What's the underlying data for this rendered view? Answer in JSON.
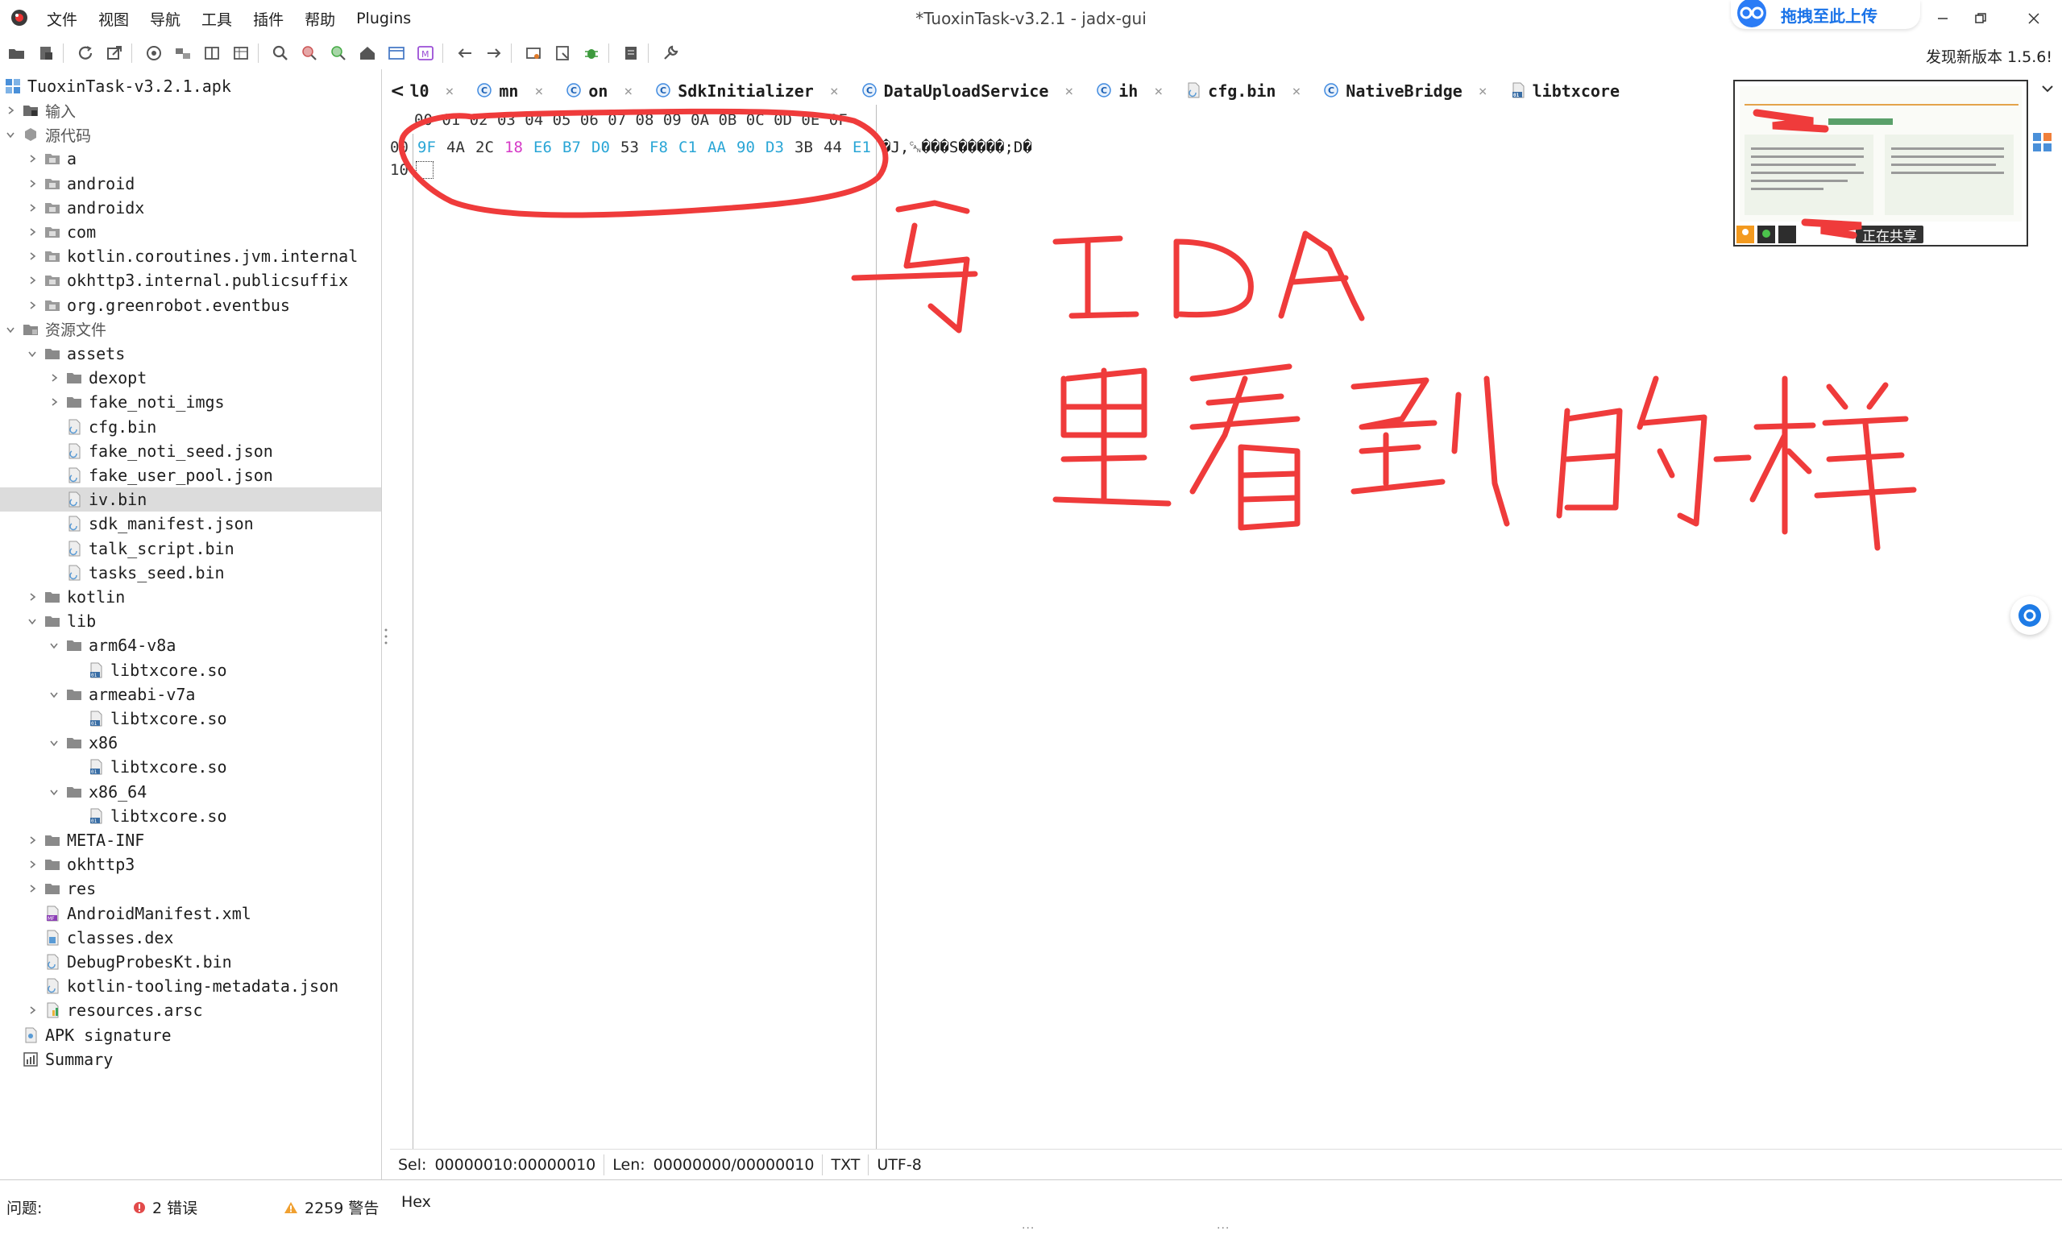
{
  "app": {
    "window_title": "*TuoxinTask-v3.2.1 - jadx-gui",
    "update_notice": "发现新版本 1.5.6!"
  },
  "menu": [
    "文件",
    "视图",
    "导航",
    "工具",
    "插件",
    "帮助",
    "Plugins"
  ],
  "baidu_upload": {
    "label": "拖拽至此上传"
  },
  "tree": {
    "root": "TuoxinTask-v3.2.1.apk",
    "items": [
      {
        "label": "输入",
        "depth": 1,
        "arrow": "right",
        "icon": "input-folder-icon",
        "cjk": true
      },
      {
        "label": "源代码",
        "depth": 1,
        "arrow": "down",
        "icon": "source-folder-icon",
        "cjk": true
      },
      {
        "label": "a",
        "depth": 2,
        "arrow": "right",
        "icon": "package-icon"
      },
      {
        "label": "android",
        "depth": 2,
        "arrow": "right",
        "icon": "package-icon"
      },
      {
        "label": "androidx",
        "depth": 2,
        "arrow": "right",
        "icon": "package-icon"
      },
      {
        "label": "com",
        "depth": 2,
        "arrow": "right",
        "icon": "package-icon"
      },
      {
        "label": "kotlin.coroutines.jvm.internal",
        "depth": 2,
        "arrow": "right",
        "icon": "package-icon"
      },
      {
        "label": "okhttp3.internal.publicsuffix",
        "depth": 2,
        "arrow": "right",
        "icon": "package-icon"
      },
      {
        "label": "org.greenrobot.eventbus",
        "depth": 2,
        "arrow": "right",
        "icon": "package-icon"
      },
      {
        "label": "资源文件",
        "depth": 1,
        "arrow": "down",
        "icon": "resource-folder-icon",
        "cjk": true
      },
      {
        "label": "assets",
        "depth": 2,
        "arrow": "down",
        "icon": "folder-icon"
      },
      {
        "label": "dexopt",
        "depth": 3,
        "arrow": "right",
        "icon": "folder-icon"
      },
      {
        "label": "fake_noti_imgs",
        "depth": 3,
        "arrow": "right",
        "icon": "folder-icon"
      },
      {
        "label": "cfg.bin",
        "depth": 3,
        "arrow": "none",
        "icon": "file-icon"
      },
      {
        "label": "fake_noti_seed.json",
        "depth": 3,
        "arrow": "none",
        "icon": "file-icon"
      },
      {
        "label": "fake_user_pool.json",
        "depth": 3,
        "arrow": "none",
        "icon": "file-icon"
      },
      {
        "label": "iv.bin",
        "depth": 3,
        "arrow": "none",
        "icon": "file-icon",
        "selected": true
      },
      {
        "label": "sdk_manifest.json",
        "depth": 3,
        "arrow": "none",
        "icon": "file-icon"
      },
      {
        "label": "talk_script.bin",
        "depth": 3,
        "arrow": "none",
        "icon": "file-icon"
      },
      {
        "label": "tasks_seed.bin",
        "depth": 3,
        "arrow": "none",
        "icon": "file-icon"
      },
      {
        "label": "kotlin",
        "depth": 2,
        "arrow": "right",
        "icon": "folder-icon"
      },
      {
        "label": "lib",
        "depth": 2,
        "arrow": "down",
        "icon": "folder-icon"
      },
      {
        "label": "arm64-v8a",
        "depth": 3,
        "arrow": "down",
        "icon": "folder-icon"
      },
      {
        "label": "libtxcore.so",
        "depth": 4,
        "arrow": "none",
        "icon": "binary-file-icon"
      },
      {
        "label": "armeabi-v7a",
        "depth": 3,
        "arrow": "down",
        "icon": "folder-icon"
      },
      {
        "label": "libtxcore.so",
        "depth": 4,
        "arrow": "none",
        "icon": "binary-file-icon"
      },
      {
        "label": "x86",
        "depth": 3,
        "arrow": "down",
        "icon": "folder-icon"
      },
      {
        "label": "libtxcore.so",
        "depth": 4,
        "arrow": "none",
        "icon": "binary-file-icon"
      },
      {
        "label": "x86_64",
        "depth": 3,
        "arrow": "down",
        "icon": "folder-icon"
      },
      {
        "label": "libtxcore.so",
        "depth": 4,
        "arrow": "none",
        "icon": "binary-file-icon"
      },
      {
        "label": "META-INF",
        "depth": 2,
        "arrow": "right",
        "icon": "folder-icon"
      },
      {
        "label": "okhttp3",
        "depth": 2,
        "arrow": "right",
        "icon": "folder-icon"
      },
      {
        "label": "res",
        "depth": 2,
        "arrow": "right",
        "icon": "folder-icon"
      },
      {
        "label": "AndroidManifest.xml",
        "depth": 2,
        "arrow": "none",
        "icon": "manifest-file-icon"
      },
      {
        "label": "classes.dex",
        "depth": 2,
        "arrow": "none",
        "icon": "dex-file-icon"
      },
      {
        "label": "DebugProbesKt.bin",
        "depth": 2,
        "arrow": "none",
        "icon": "file-icon"
      },
      {
        "label": "kotlin-tooling-metadata.json",
        "depth": 2,
        "arrow": "none",
        "icon": "file-icon"
      },
      {
        "label": "resources.arsc",
        "depth": 2,
        "arrow": "right",
        "icon": "arsc-file-icon"
      },
      {
        "label": "APK signature",
        "depth": 1,
        "arrow": "none",
        "icon": "signature-icon"
      },
      {
        "label": "Summary",
        "depth": 1,
        "arrow": "none",
        "icon": "summary-icon"
      }
    ]
  },
  "tabs": [
    {
      "label": "l0",
      "icon": "none"
    },
    {
      "label": "mn",
      "icon": "class-icon"
    },
    {
      "label": "on",
      "icon": "class-icon"
    },
    {
      "label": "SdkInitializer",
      "icon": "class-icon"
    },
    {
      "label": "DataUploadService",
      "icon": "class-icon"
    },
    {
      "label": "ih",
      "icon": "class-icon"
    },
    {
      "label": "cfg.bin",
      "icon": "file-icon"
    },
    {
      "label": "NativeBridge",
      "icon": "class-icon"
    },
    {
      "label": "libtxcore",
      "icon": "binary-file-icon"
    }
  ],
  "hex": {
    "header": "00 01 02 03 04 05 06 07 08 09 0A 0B 0C 0D 0E 0F",
    "offsets": [
      "00",
      "10"
    ],
    "bytes": [
      {
        "v": "9F",
        "c": "#2aa6d6"
      },
      {
        "v": "4A",
        "c": "#333333"
      },
      {
        "v": "2C",
        "c": "#333333"
      },
      {
        "v": "18",
        "c": "#d63ac7"
      },
      {
        "v": "E6",
        "c": "#2aa6d6"
      },
      {
        "v": "B7",
        "c": "#2aa6d6"
      },
      {
        "v": "D0",
        "c": "#2aa6d6"
      },
      {
        "v": "53",
        "c": "#333333"
      },
      {
        "v": "F8",
        "c": "#2aa6d6"
      },
      {
        "v": "C1",
        "c": "#2aa6d6"
      },
      {
        "v": "AA",
        "c": "#2aa6d6"
      },
      {
        "v": "90",
        "c": "#2aa6d6"
      },
      {
        "v": "D3",
        "c": "#2aa6d6"
      },
      {
        "v": "3B",
        "c": "#333333"
      },
      {
        "v": "44",
        "c": "#333333"
      },
      {
        "v": "E1",
        "c": "#2aa6d6"
      }
    ],
    "ascii": "�J,␘���S�����;D�"
  },
  "status": {
    "sel_label": "Sel:",
    "sel_value": "00000010:00000010",
    "len_label": "Len:",
    "len_value": "00000000/00000010",
    "mode": "TXT",
    "encoding": "UTF-8"
  },
  "bottom": {
    "problems_label": "问题:",
    "errors": "2 错误",
    "warnings": "2259 警告",
    "hex_tab": "Hex"
  },
  "share": {
    "status": "正在共享"
  },
  "colors": {
    "annotation": "#ef3b3b",
    "byte_high": "#2aa6d6",
    "byte_ctrl": "#d63ac7",
    "selection": "#dcdcdc"
  }
}
